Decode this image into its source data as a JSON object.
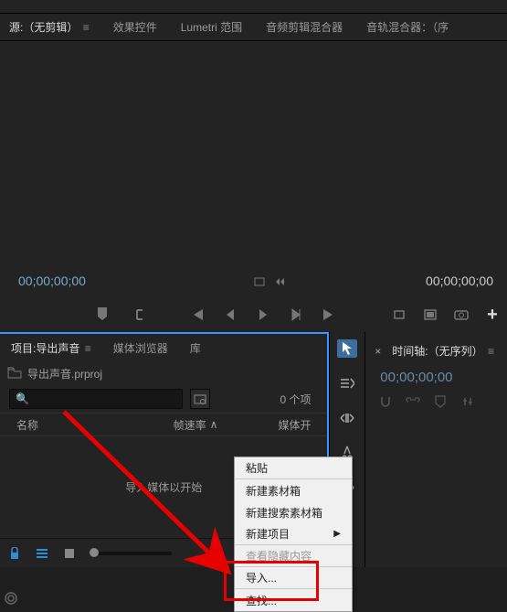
{
  "source_tabs": {
    "source": "源:（无剪辑）",
    "effects": "效果控件",
    "lumetri": "Lumetri 范围",
    "audio_clip_mixer": "音频剪辑混合器",
    "audio_track_mixer": "音轨混合器：（序"
  },
  "monitor": {
    "timecode_left": "00;00;00;00",
    "timecode_right": "00;00;00;00"
  },
  "project": {
    "tab_project": "项目:导出声音",
    "tab_media_browser": "媒体浏览器",
    "tab_library": "库",
    "filename": "导出声音.prproj",
    "search_placeholder": "",
    "items_count": "0 个项",
    "col_name": "名称",
    "col_framerate": "帧速率",
    "col_media_start": "媒体开",
    "center_hint": "导入媒体以开始"
  },
  "timeline": {
    "tab_label": "时间轴:（无序列）",
    "timecode": "00;00;00;00"
  },
  "icons": {
    "search": "🔍",
    "folder": "folder",
    "marker": "marker"
  },
  "context_menu": {
    "paste": "粘贴",
    "new_bin": "新建素材箱",
    "new_search_bin": "新建搜索素材箱",
    "new_item": "新建项目",
    "show_hidden": "查看隐藏内容",
    "import": "导入...",
    "find": "查找..."
  }
}
